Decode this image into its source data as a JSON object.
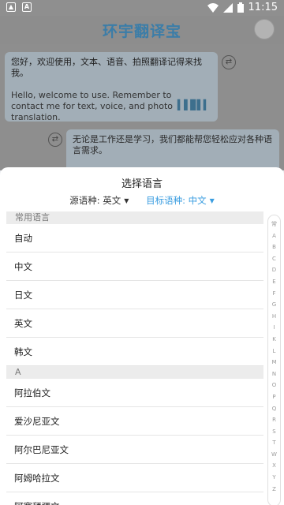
{
  "status_bar": {
    "time": "11:15"
  },
  "header": {
    "title": "环宇翻译宝"
  },
  "chat": {
    "bubble1_cn": "您好，欢迎使用，文本、语音、拍照翻译记得来找我。",
    "bubble1_en": "Hello, welcome to use. Remember to contact me for text, voice, and photo translation.",
    "bubble2_cn": "无论是工作还是学习，我们都能帮您轻松应对各种语言需求。"
  },
  "sheet": {
    "title": "选择语言",
    "source_label": "源语种: 英文",
    "target_label": "目标语种: 中文",
    "sections": [
      {
        "header": "常用语言",
        "items": [
          "自动",
          "中文",
          "日文",
          "英文",
          "韩文"
        ]
      },
      {
        "header": "A",
        "items": [
          "阿拉伯文",
          "爱沙尼亚文",
          "阿尔巴尼亚文",
          "阿姆哈拉文",
          "阿塞拜疆文"
        ]
      }
    ],
    "index_letters": [
      "常",
      "A",
      "B",
      "C",
      "D",
      "E",
      "F",
      "G",
      "H",
      "I",
      "K",
      "L",
      "M",
      "N",
      "O",
      "P",
      "Q",
      "R",
      "S",
      "T",
      "W",
      "X",
      "Y",
      "Z"
    ]
  }
}
